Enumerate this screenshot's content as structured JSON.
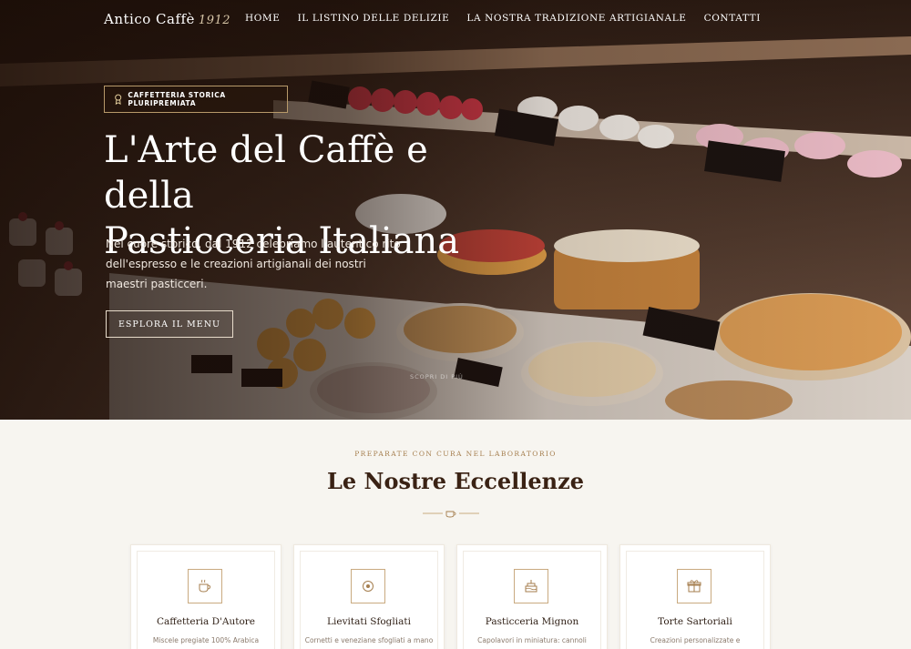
{
  "nav": {
    "brand": "Antico Caffè",
    "brand_year": "1912",
    "links": [
      "HOME",
      "IL LISTINO DELLE DELIZIE",
      "LA NOSTRA TRADIZIONE ARTIGIANALE",
      "CONTATTI"
    ]
  },
  "hero": {
    "badge": "CAFFETTERIA STORICA PLURIPREMIATA",
    "badge_icon": "award-icon",
    "title_line1": "L'Arte del Caffè e della",
    "title_line2": "Pasticceria Italiana",
    "subtitle": "Nel cuore storico, dal 1912 celebriamo l'autentico rito dell'espresso e le creazioni artigianali dei nostri maestri pasticceri.",
    "cta": "ESPLORA IL MENU",
    "scroll": "SCOPRI DI PIÙ"
  },
  "section": {
    "eyebrow": "PREPARATE CON CURA NEL LABORATORIO",
    "title": "Le Nostre Eccellenze",
    "divider_icon": "coffee-cup-icon"
  },
  "cards": [
    {
      "title": "Caffetteria D'Autore",
      "desc": "Miscele pregiate 100% Arabica",
      "icon": "coffee-cup-icon"
    },
    {
      "title": "Lievitati Sfogliati",
      "desc": "Cornetti e veneziane sfogliati a mano",
      "icon": "croissant-icon"
    },
    {
      "title": "Pasticceria Mignon",
      "desc": "Capolavori in miniatura: cannoli",
      "icon": "cake-icon"
    },
    {
      "title": "Torte Sartoriali",
      "desc": "Creazioni personalizzate e",
      "icon": "gift-icon"
    }
  ],
  "colors": {
    "accent": "#a57e4e",
    "dark": "#3a2214",
    "background": "#f7f5f0"
  }
}
